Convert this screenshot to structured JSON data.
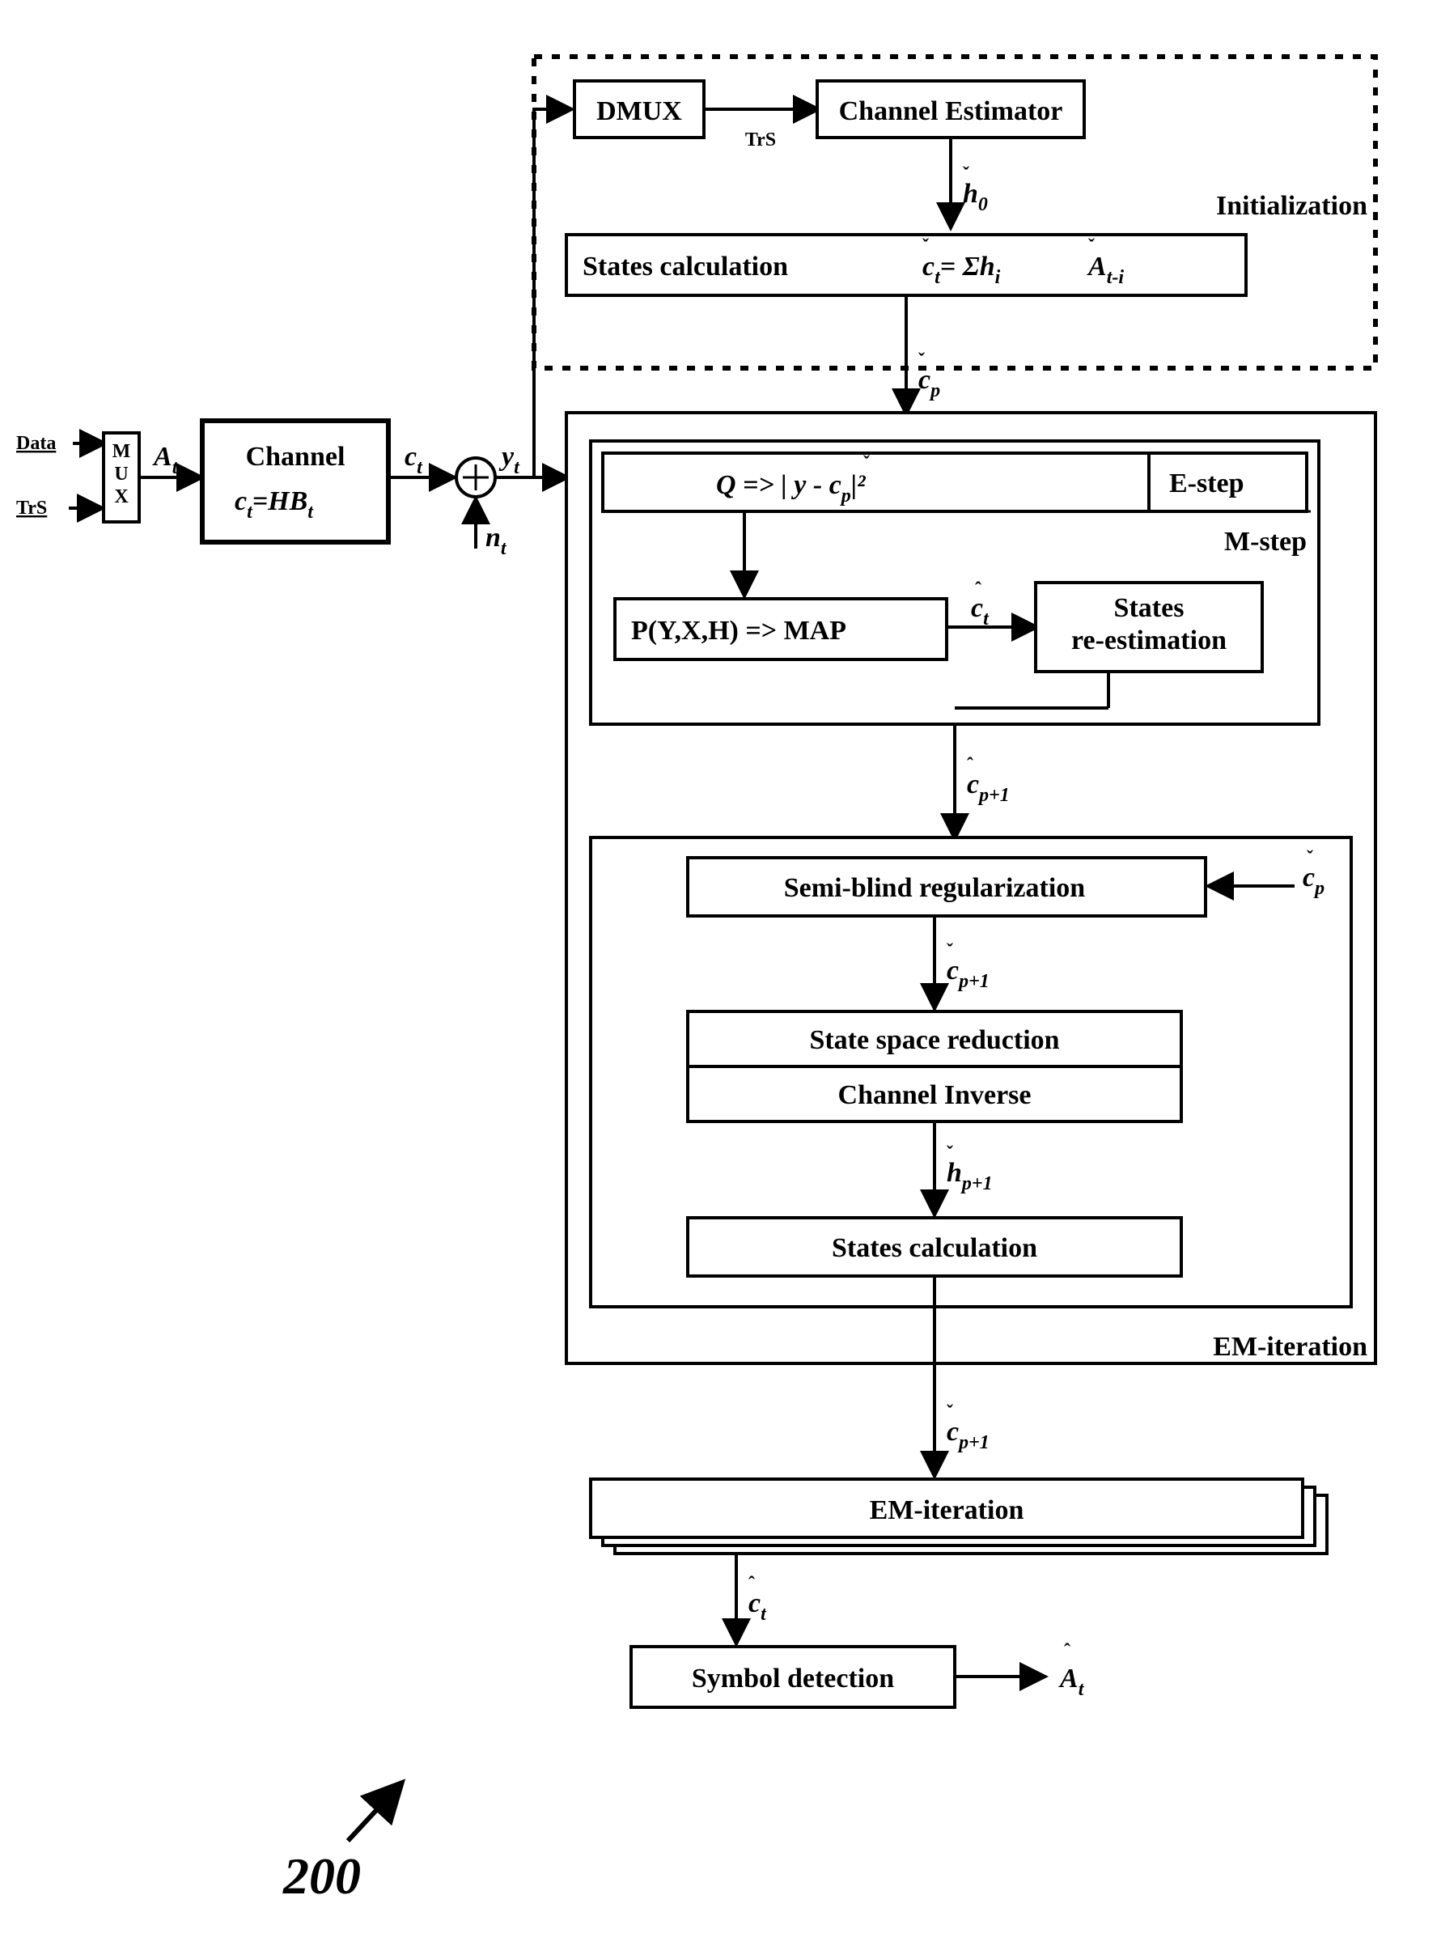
{
  "fig_label": "200",
  "inputs": {
    "data": "Data",
    "trs": "TrS"
  },
  "mux": "MUX",
  "mux_out": "A",
  "mux_out_sub": "t",
  "channel": {
    "title": "Channel",
    "eq1": "c",
    "eq1_sub": "t",
    "eq2": "=HB",
    "eq2_sub": "t"
  },
  "c": "c",
  "c_sub": "t",
  "n": "n",
  "n_sub": "t",
  "y": "y",
  "y_sub": "t",
  "init": {
    "dmux": "DMUX",
    "trs": "TrS",
    "ce": "Channel Estimator",
    "h0": "h",
    "h0_sub": "0",
    "sc": "States calculation",
    "sc_eq1": "c",
    "sc_eq1_sub": "t",
    "sc_eq2": "= Σh",
    "sc_eq2_sub": "i",
    "sc_eq3": "A",
    "sc_eq3_sub": "t-i",
    "label": "Initialization"
  },
  "cp": "c",
  "cp_sub": "p",
  "em": {
    "estep": "E-step",
    "mstep": "M-step",
    "q": "Q => | y - c",
    "q_sub": "p",
    "q_end": "|²",
    "map": "P(Y,X,H) => MAP",
    "ct": "c",
    "ct_sub": "t",
    "sre": "States re-estimation",
    "label": "EM-iteration"
  },
  "cp1": "c",
  "cp1_sub": "p+1",
  "sbr": "Semi-blind regularization",
  "ssr": "State space reduction",
  "cinv": "Channel Inverse",
  "hp1": "h",
  "hp1_sub": "p+1",
  "sc2": "States calculation",
  "emit": "EM-iteration",
  "sd": "Symbol detection",
  "At": "A",
  "At_sub": "t"
}
